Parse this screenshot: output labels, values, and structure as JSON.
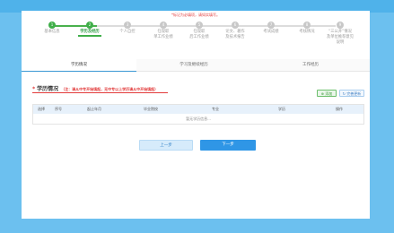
{
  "notice": "*标记为必填项，请如实填写。",
  "steps": [
    {
      "num": "1",
      "label": "基本信息",
      "state": "done"
    },
    {
      "num": "2",
      "label": "学历及经历",
      "state": "active"
    },
    {
      "num": "3",
      "label": "个人自控",
      "state": "todo"
    },
    {
      "num": "4",
      "label": "任现职\n单工作业绩",
      "state": "todo"
    },
    {
      "num": "5",
      "label": "任现职\n后工作业绩",
      "state": "todo"
    },
    {
      "num": "6",
      "label": "论文、著作\n及技术报告",
      "state": "todo"
    },
    {
      "num": "7",
      "label": "考试成绩",
      "state": "todo"
    },
    {
      "num": "8",
      "label": "考核情况",
      "state": "todo"
    },
    {
      "num": "9",
      "label": "“三公开”情况\n及单位推荐意见\n说明",
      "state": "todo"
    }
  ],
  "tabs": [
    {
      "label": "学历情况",
      "active": true
    },
    {
      "label": "学习及继续经历",
      "active": false
    },
    {
      "label": "工作经历",
      "active": false
    }
  ],
  "section": {
    "star": "*",
    "title": "学历情况",
    "note": "（注：请从中专开始填起，无中专以上学历请从中开始填起）",
    "add_label": "添加",
    "save_label": "完善更新"
  },
  "table": {
    "headers": [
      "选择",
      "序号",
      "起止年月",
      "毕业院校",
      "专业",
      "学历",
      "操作"
    ],
    "empty_text": "暂无学历信息..."
  },
  "buttons": {
    "prev": "上一步",
    "next": "下一步"
  }
}
